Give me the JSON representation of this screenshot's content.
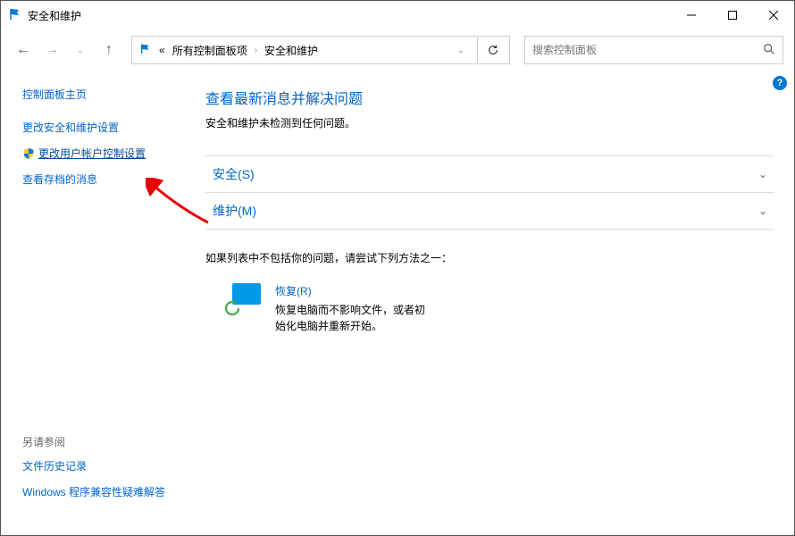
{
  "window": {
    "title": "安全和维护"
  },
  "breadcrumb": {
    "prefix": "«",
    "item1": "所有控制面板项",
    "item2": "安全和维护"
  },
  "search": {
    "placeholder": "搜索控制面板"
  },
  "sidebar": {
    "home": "控制面板主页",
    "change_security": "更改安全和维护设置",
    "change_uac": "更改用户帐户控制设置",
    "archived_messages": "查看存档的消息",
    "see_also": "另请参阅",
    "file_history": "文件历史记录",
    "compat_troubleshoot": "Windows 程序兼容性疑难解答"
  },
  "main": {
    "heading": "查看最新消息并解决问题",
    "no_issues": "安全和维护未检测到任何问题。",
    "security_label": "安全(S)",
    "maintenance_label": "维护(M)",
    "troubleshoot_hint": "如果列表中不包括你的问题，请尝试下列方法之一：",
    "recovery_title": "恢复(R)",
    "recovery_desc": "恢复电脑而不影响文件，或者初始化电脑并重新开始。"
  }
}
